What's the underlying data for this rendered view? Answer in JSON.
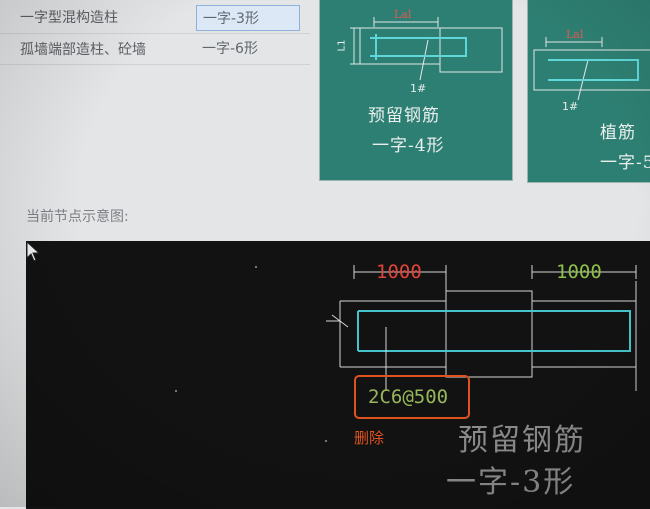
{
  "table": {
    "rows": [
      {
        "label": "一字型混构造柱",
        "value": "一字-3形",
        "selected": true
      },
      {
        "label": "孤墙端部造柱、砼墙",
        "value": "一字-6形",
        "selected": false
      }
    ]
  },
  "thumbnails": [
    {
      "caption_line1": "预留钢筋",
      "caption_line2": "一字-4形",
      "dim_label": "Lal",
      "side_label": "L1",
      "marker": "1#"
    },
    {
      "caption_line1": "植筋",
      "caption_line2": "一字-5",
      "dim_label": "Lal",
      "marker": "1#"
    }
  ],
  "section_label": "当前节点示意图:",
  "preview": {
    "dimension_left": "1000",
    "dimension_right": "1000",
    "rebar_spec": "2C6@500",
    "delete_label": "删除",
    "caption_line1": "预留钢筋",
    "caption_line2": "一字-3形",
    "colors": {
      "left_dim": "#e0433a",
      "right_dim": "#8cc04a",
      "rebar": "#46c3cc",
      "highlight": "#e0521e"
    }
  }
}
